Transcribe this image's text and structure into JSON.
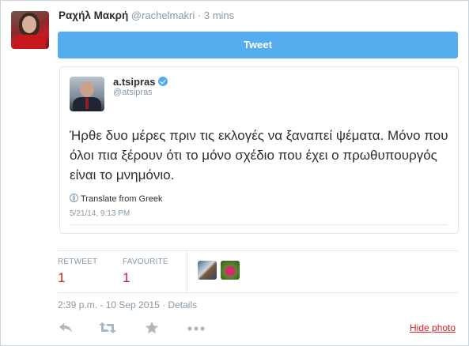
{
  "header": {
    "name": "Ραχήλ Μακρή",
    "handle": "@rachelmakri",
    "separator": "·",
    "time": "3 mins"
  },
  "tweet_button": {
    "label": "Tweet"
  },
  "embedded": {
    "name": "a.tsipras",
    "handle": "@atsipras",
    "text": "Ήρθε δυο μέρες πριν τις εκλογές να ξαναπεί ψέματα. Μόνο που όλοι πια ξέρουν ότι το μόνο σχέδιο που έχει ο πρωθυπουργός είναι το μνημόνιο.",
    "translate_label": "Translate from Greek",
    "date": "5/21/14, 9:13 PM"
  },
  "stats": {
    "retweet_label": "RETWEET",
    "retweet_count": "1",
    "favourite_label": "FAVOURITE",
    "favourite_count": "1"
  },
  "meta": {
    "text": "2:39 p.m. - 10 Sep 2015 · Details"
  },
  "actions": {
    "icons": [
      "reply-icon",
      "retweet-icon",
      "favorite-icon",
      "more-icon"
    ],
    "hide_photo": "Hide photo"
  },
  "colors": {
    "accent": "#55acee",
    "count_red": "#d41f26",
    "muted": "#8899a6"
  }
}
